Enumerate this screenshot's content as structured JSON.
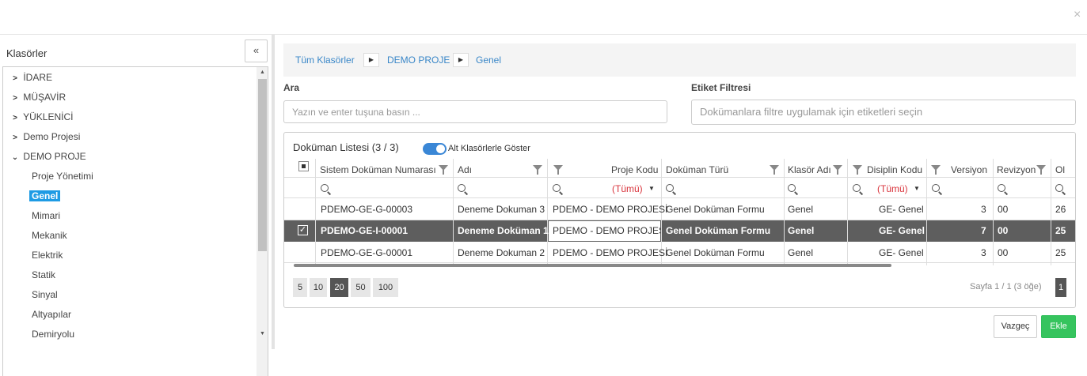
{
  "dialog": {
    "close_icon": "×"
  },
  "sidebar": {
    "title": "Klasörler",
    "collapse_icon": "«",
    "items": [
      {
        "label": "İDARE",
        "expanded": false
      },
      {
        "label": "MÜŞAVİR",
        "expanded": false
      },
      {
        "label": "YÜKLENİCİ",
        "expanded": false
      },
      {
        "label": "Demo Projesi",
        "expanded": false
      },
      {
        "label": "DEMO PROJE",
        "expanded": true
      },
      {
        "label": "Proje Yönetimi"
      },
      {
        "label": "Genel",
        "selected": true
      },
      {
        "label": "Mimari"
      },
      {
        "label": "Mekanik"
      },
      {
        "label": "Elektrik"
      },
      {
        "label": "Statik"
      },
      {
        "label": "Sinyal"
      },
      {
        "label": "Altyapılar"
      },
      {
        "label": "Demiryolu"
      }
    ]
  },
  "breadcrumb": [
    "Tüm Klasörler",
    "DEMO PROJE",
    "Genel"
  ],
  "search": {
    "label": "Ara",
    "placeholder": "Yazın ve enter tuşuna basın ..."
  },
  "tag_filter": {
    "label": "Etiket Filtresi",
    "placeholder": "Dokümanlara filtre uygulamak için etiketleri seçin"
  },
  "grid": {
    "title": "Doküman Listesi (3 / 3)",
    "toggle_label": "Alt Klasörlerle Göster",
    "toggle_on": true,
    "columns": [
      "Sistem Doküman Numarası",
      "Adı",
      "Proje Kodu",
      "Doküman Türü",
      "Klasör Adı",
      "Disiplin Kodu",
      "Versiyon",
      "Revizyon",
      "Ol"
    ],
    "filter_all": "(Tümü)",
    "rows": [
      {
        "no": "PDEMO-GE-G-00003",
        "name": "Deneme Dokuman 3",
        "project": "PDEMO - DEMO PROJESİ",
        "type": "Genel Doküman Formu",
        "folder": "Genel",
        "discipline": "GE- Genel",
        "version": "3",
        "revision": "00",
        "ol": "26",
        "selected": false
      },
      {
        "no": "PDEMO-GE-I-00001",
        "name": "Deneme Doküman 1",
        "project": "PDEMO - DEMO PROJESİ",
        "type": "Genel Doküman Formu",
        "folder": "Genel",
        "discipline": "GE- Genel",
        "version": "7",
        "revision": "00",
        "ol": "25",
        "selected": true
      },
      {
        "no": "PDEMO-GE-G-00001",
        "name": "Deneme Dokuman 2",
        "project": "PDEMO - DEMO PROJESİ",
        "type": "Genel Doküman Formu",
        "folder": "Genel",
        "discipline": "GE- Genel",
        "version": "3",
        "revision": "00",
        "ol": "25",
        "selected": false
      }
    ],
    "page_sizes": [
      "5",
      "10",
      "20",
      "50",
      "100"
    ],
    "active_page_size": "20",
    "page_info": "Sayfa 1 / 1 (3 öğe)",
    "current_page": "1",
    "checked_mark": "✓"
  },
  "actions": {
    "cancel": "Vazgeç",
    "add": "Ekle"
  },
  "colors": {
    "accent": "#1e9be4",
    "link": "#3a87c8",
    "selected_row": "#5e5e5e",
    "add_button": "#36c45e",
    "filter_red": "#d9363e"
  }
}
